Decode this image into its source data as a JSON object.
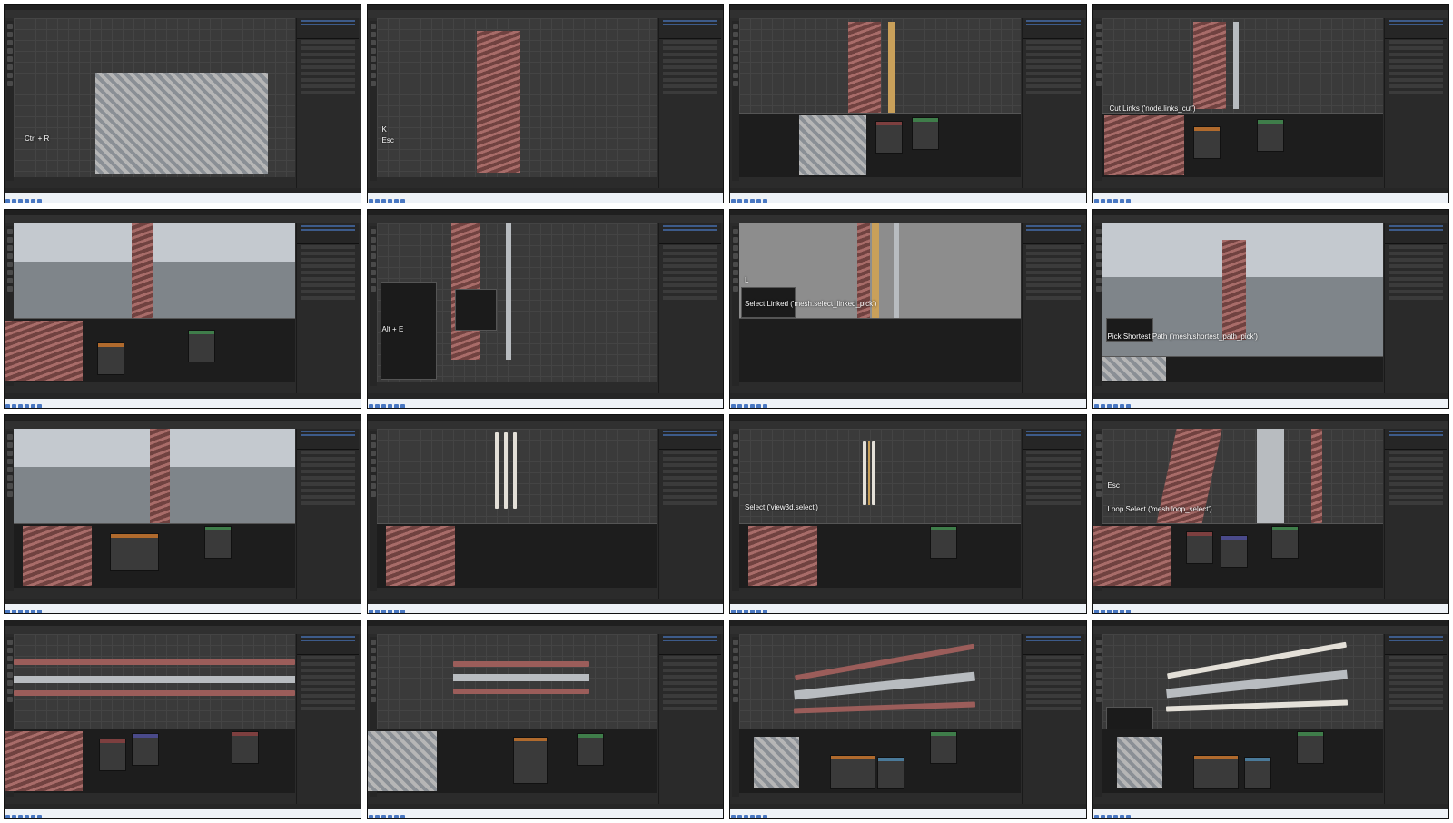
{
  "thumbnails": [
    {
      "overlay_lines": [
        "Ctrl + R"
      ]
    },
    {
      "overlay_lines": [
        "K",
        "Esc"
      ]
    },
    {
      "overlay_lines": []
    },
    {
      "overlay_lines": [
        "Cut Links ('node.links_cut')"
      ]
    },
    {
      "overlay_lines": []
    },
    {
      "overlay_lines": [
        "Alt + E"
      ]
    },
    {
      "overlay_lines": [
        "L",
        "Select Linked ('mesh.select_linked_pick')"
      ]
    },
    {
      "overlay_lines": [
        "Pick Shortest Path ('mesh.shortest_path_pick')"
      ]
    },
    {
      "overlay_lines": []
    },
    {
      "overlay_lines": []
    },
    {
      "overlay_lines": [
        "Select ('view3d.select')"
      ]
    },
    {
      "overlay_lines": [
        "Esc",
        "Loop Select ('mesh.loop_select')"
      ]
    },
    {
      "overlay_lines": []
    },
    {
      "overlay_lines": []
    },
    {
      "overlay_lines": []
    },
    {
      "overlay_lines": []
    }
  ],
  "colors": {
    "background": "#2b2b2b",
    "node_header_red": "#7d3f3f",
    "node_header_green": "#3f7d4a",
    "node_header_orange": "#b06a2d",
    "selection_orange": "#e8963a",
    "accent_blue": "#4a6fa5"
  }
}
